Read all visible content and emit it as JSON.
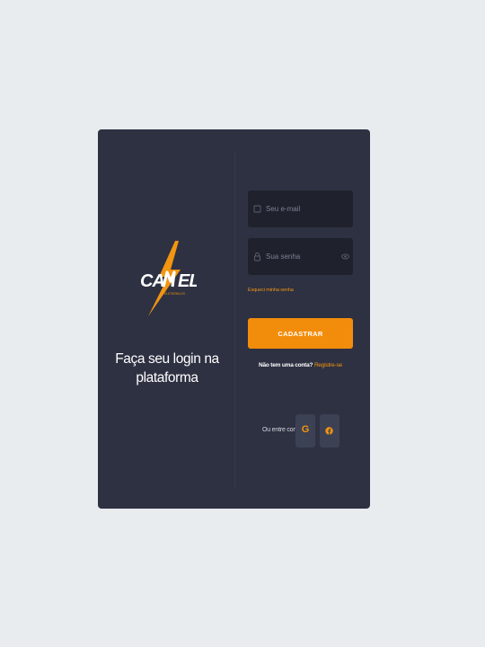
{
  "brand": {
    "logo_text": "CAMEL",
    "logo_subtext": "ELETRÔNICOS",
    "tagline": "Faça seu login na plataforma",
    "accent_color": "#f28d0b"
  },
  "form": {
    "email": {
      "placeholder": "Seu e-mail",
      "value": "",
      "icon": "mail-icon"
    },
    "password": {
      "placeholder": "Sua senha",
      "value": "",
      "icon": "lock-icon",
      "toggle_icon": "eye-icon"
    },
    "forgot_password": "Esqueci minha senha",
    "submit_label": "CADASTRAR",
    "register_question": "Não tem uma conta?",
    "register_link": "Registre-se"
  },
  "social": {
    "label": "Ou entre com",
    "google_glyph": "G",
    "google_icon": "google-icon",
    "facebook_icon": "facebook-icon"
  }
}
